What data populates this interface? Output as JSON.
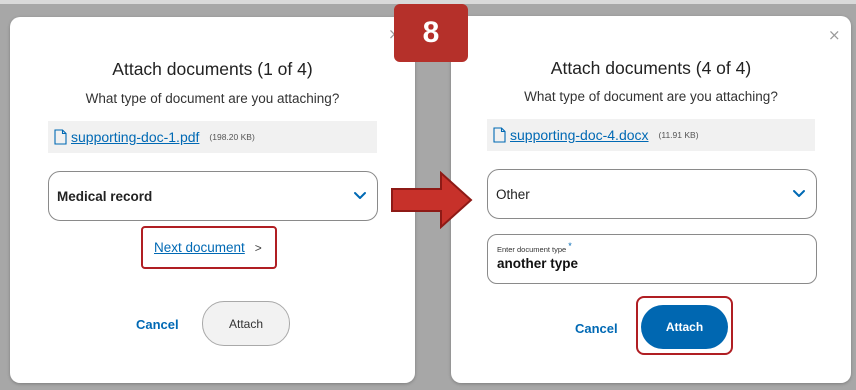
{
  "left_dialog": {
    "title": "Attach documents (1 of 4)",
    "subtitle": "What type of document are you attaching?",
    "file": {
      "name": "supporting-doc-1.pdf",
      "size": "(198.20 KB)"
    },
    "doc_type": "Medical record",
    "next_link": "Next document",
    "next_arrow": ">",
    "cancel_label": "Cancel",
    "attach_label": "Attach",
    "close_icon": "×"
  },
  "right_dialog": {
    "title": "Attach documents (4 of 4)",
    "subtitle": "What type of document are you attaching?",
    "file": {
      "name": "supporting-doc-4.docx",
      "size": "(11.91 KB)"
    },
    "doc_type": "Other",
    "doc_type_field": {
      "label": "Enter document type",
      "required_mark": "*",
      "value": "another type"
    },
    "cancel_label": "Cancel",
    "attach_label": "Attach",
    "close_icon": "×"
  },
  "step_badge": "8",
  "colors": {
    "link": "#0069b4",
    "primary_button": "#0067b1",
    "highlight": "#b01e23",
    "badge": "#b5302a",
    "backdrop": "#a7a7a7"
  }
}
